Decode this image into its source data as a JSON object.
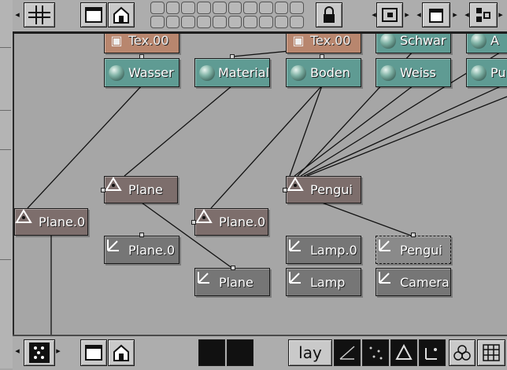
{
  "colors": {
    "material_node": "#5f9b93",
    "object_node": "#7d6e6c",
    "lamp_camera_node": "#767676",
    "texture_node": "#b8866e",
    "canvas_bg": "#a6a6a6",
    "toolbar_bg": "#adadad"
  },
  "toolbar_bottom": {
    "layer_label": "lay"
  },
  "nodes": {
    "tex1": "Tex.00",
    "tex2": "Tex.00",
    "schwarz": "Schwar",
    "a_partial": "A",
    "wasser": "Wasser",
    "material": "Material",
    "boden": "Boden",
    "weiss": "Weiss",
    "pu_partial": "Pu",
    "plane_a": "Plane",
    "pengui_obj": "Pengui",
    "plane0_left": "Plane.0",
    "plane0_mid": "Plane.0",
    "plane0_mesh": "Plane.0",
    "lamp0": "Lamp.0",
    "pengui_mesh": "Pengui",
    "plane_mesh": "Plane",
    "lamp": "Lamp",
    "camera": "Camera"
  },
  "icons": {
    "grid": "grid-icon",
    "lock": "lock-icon",
    "material": "sphere-icon",
    "object": "triangle-axis-icon",
    "mesh": "mesh-axis-icon"
  }
}
